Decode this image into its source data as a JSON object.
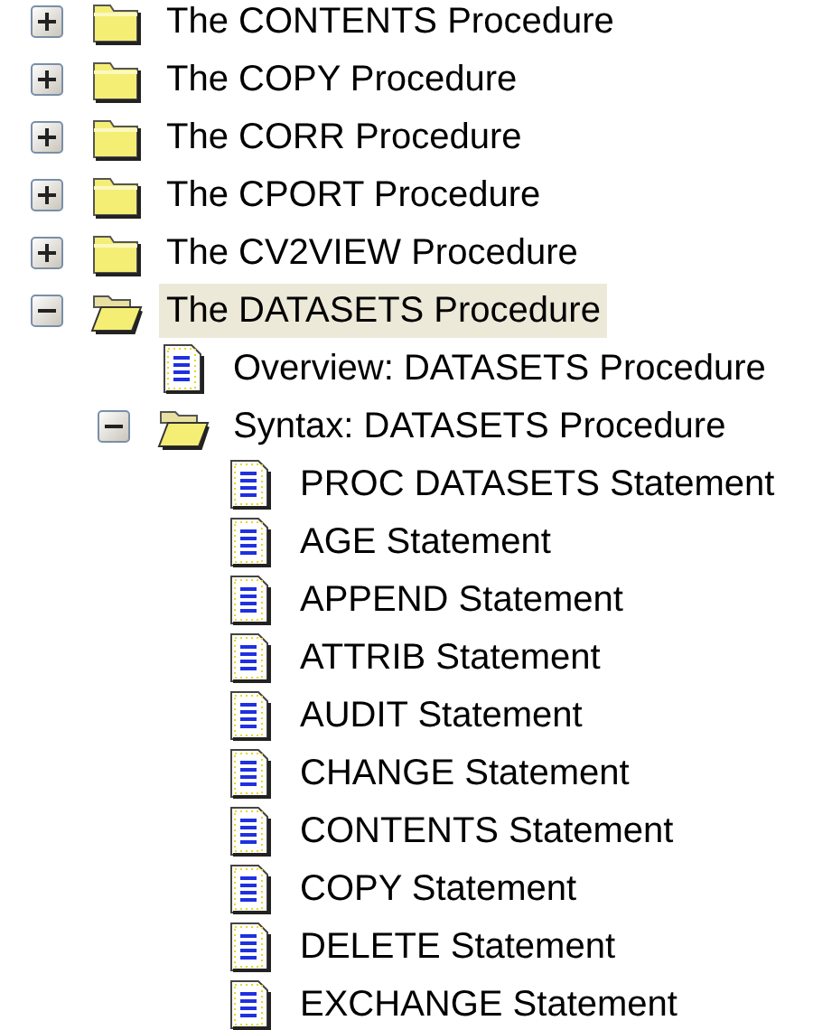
{
  "tree": {
    "items": [
      {
        "label": "The CONTENTS Procedure",
        "kind": "folder",
        "expanded": false,
        "selected": false
      },
      {
        "label": "The COPY Procedure",
        "kind": "folder",
        "expanded": false,
        "selected": false
      },
      {
        "label": "The CORR Procedure",
        "kind": "folder",
        "expanded": false,
        "selected": false
      },
      {
        "label": "The CPORT Procedure",
        "kind": "folder",
        "expanded": false,
        "selected": false
      },
      {
        "label": "The CV2VIEW Procedure",
        "kind": "folder",
        "expanded": false,
        "selected": false
      },
      {
        "label": "The DATASETS Procedure",
        "kind": "folder",
        "expanded": true,
        "selected": true,
        "children": [
          {
            "label": "Overview: DATASETS Procedure",
            "kind": "page",
            "selected": false
          },
          {
            "label": "Syntax: DATASETS Procedure",
            "kind": "folder",
            "expanded": true,
            "selected": false,
            "children": [
              {
                "label": "PROC DATASETS Statement",
                "kind": "page",
                "selected": false
              },
              {
                "label": "AGE Statement",
                "kind": "page",
                "selected": false
              },
              {
                "label": "APPEND Statement",
                "kind": "page",
                "selected": false
              },
              {
                "label": "ATTRIB Statement",
                "kind": "page",
                "selected": false
              },
              {
                "label": "AUDIT Statement",
                "kind": "page",
                "selected": false
              },
              {
                "label": "CHANGE Statement",
                "kind": "page",
                "selected": false
              },
              {
                "label": "CONTENTS Statement",
                "kind": "page",
                "selected": false
              },
              {
                "label": "COPY Statement",
                "kind": "page",
                "selected": false
              },
              {
                "label": "DELETE Statement",
                "kind": "page",
                "selected": false
              },
              {
                "label": "EXCHANGE Statement",
                "kind": "page",
                "selected": false
              }
            ]
          }
        ]
      }
    ]
  }
}
